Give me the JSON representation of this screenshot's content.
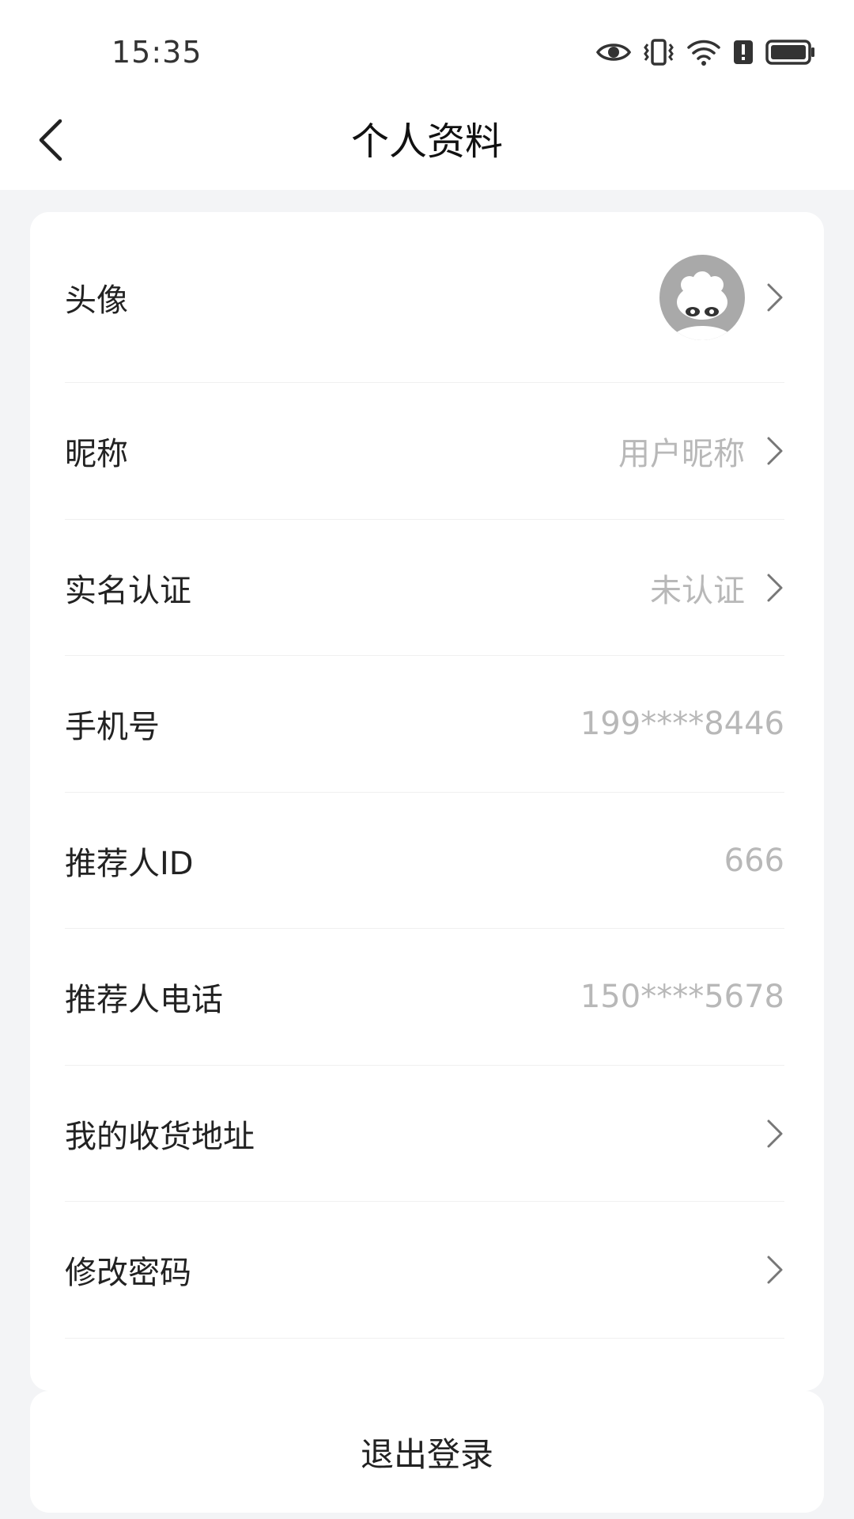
{
  "status_bar": {
    "time": "15:35",
    "icons": [
      "eye-icon",
      "vibrate-icon",
      "wifi-icon",
      "alert-icon",
      "battery-icon"
    ]
  },
  "nav": {
    "back_icon": "chevron-left-icon",
    "title": "个人资料"
  },
  "profile": {
    "avatar": {
      "label": "头像"
    },
    "nickname": {
      "label": "昵称",
      "value": "用户昵称"
    },
    "verification": {
      "label": "实名认证",
      "value": "未认证"
    },
    "phone": {
      "label": "手机号",
      "value": "199****8446"
    },
    "referrer_id": {
      "label": "推荐人ID",
      "value": "666"
    },
    "referrer_phone": {
      "label": "推荐人电话",
      "value": "150****5678"
    },
    "address": {
      "label": "我的收货地址"
    },
    "password": {
      "label": "修改密码"
    }
  },
  "logout": {
    "label": "退出登录"
  },
  "colors": {
    "background": "#f3f4f6",
    "card": "#ffffff",
    "text_primary": "#222222",
    "text_secondary": "#b8b8b8",
    "divider": "#f0f0f0"
  }
}
